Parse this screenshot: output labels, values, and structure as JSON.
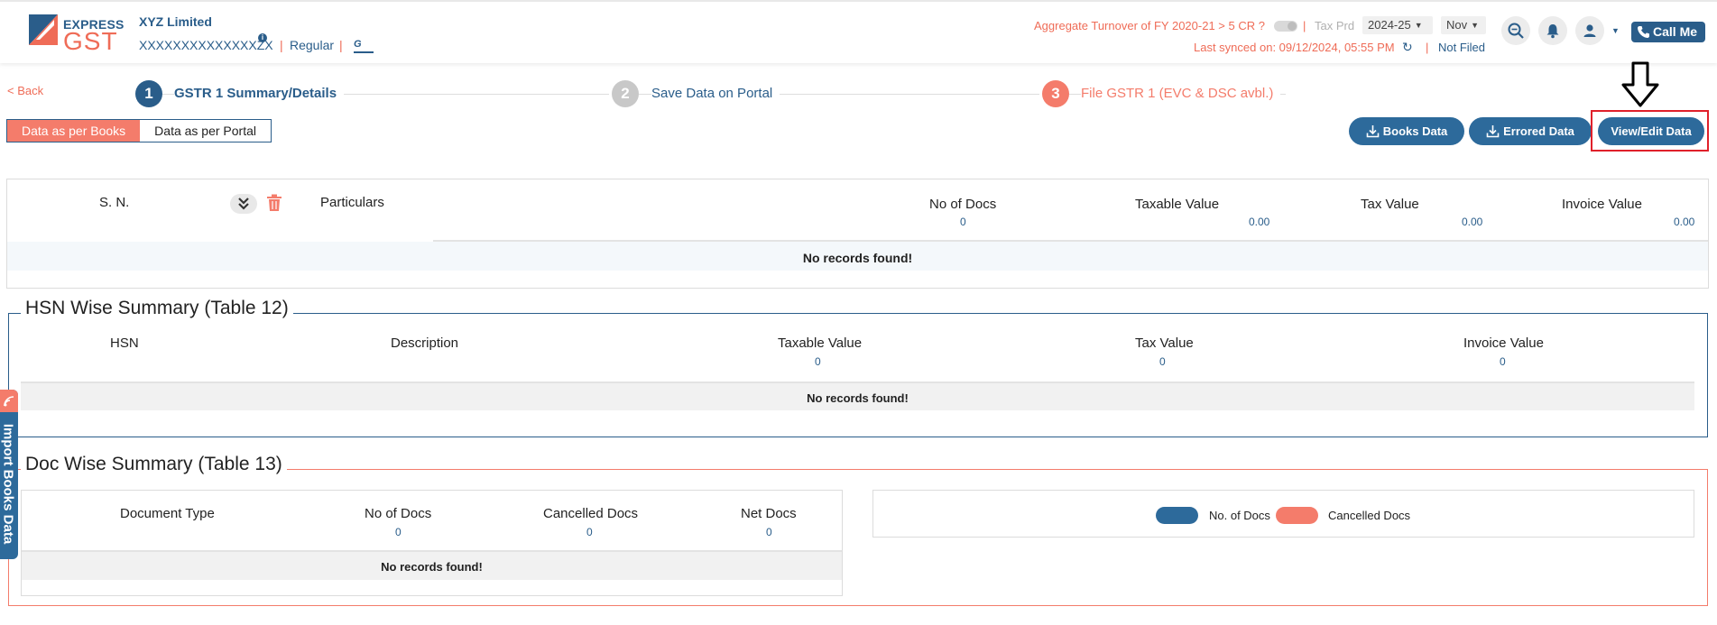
{
  "header": {
    "logo_top": "EXPRESS",
    "logo_bottom": "GST",
    "company_name": "XYZ Limited",
    "gstin": "XXXXXXXXXXXXXXZX",
    "registration_type": "Regular",
    "gstn_logo": "GSTN",
    "turnover_label": "Aggregate Turnover of FY 2020-21 > 5 CR ?",
    "tax_period_label": "Tax Prd",
    "year_value": "2024-25",
    "month_value": "Nov",
    "last_synced": "Last synced on: 09/12/2024, 05:55 PM",
    "filing_status": "Not Filed",
    "call_label": "Call Me",
    "icons": [
      "search-zoom-icon",
      "bell-icon",
      "user-icon",
      "phone-icon",
      "refresh-icon"
    ]
  },
  "steps": {
    "back_label": "< Back",
    "items": [
      {
        "number": "1",
        "label": "GSTR 1 Summary/Details"
      },
      {
        "number": "2",
        "label": "Save Data on Portal"
      },
      {
        "number": "3",
        "label": "File GSTR 1 (EVC & DSC avbl.)"
      }
    ]
  },
  "view_toggle": {
    "books_label": "Data as per Books",
    "portal_label": "Data as per Portal",
    "active": "books"
  },
  "actions": {
    "books_data_label": "Books Data",
    "errored_data_label": "Errored Data",
    "view_edit_label": "View/Edit Data"
  },
  "summary_table": {
    "columns": {
      "sn": "S. N.",
      "particulars": "Particulars",
      "no_of_docs": "No of Docs",
      "taxable_value": "Taxable Value",
      "tax_value": "Tax Value",
      "invoice_value": "Invoice Value"
    },
    "totals": {
      "no_of_docs": "0",
      "taxable_value": "0.00",
      "tax_value": "0.00",
      "invoice_value": "0.00"
    },
    "empty_message": "No records found!"
  },
  "hsn_summary": {
    "title": "HSN Wise Summary (Table 12)",
    "columns": {
      "hsn": "HSN",
      "description": "Description",
      "taxable_value": "Taxable Value",
      "tax_value": "Tax Value",
      "invoice_value": "Invoice Value"
    },
    "totals": {
      "taxable_value": "0",
      "tax_value": "0",
      "invoice_value": "0"
    },
    "empty_message": "No records found!"
  },
  "doc_summary": {
    "title": "Doc Wise Summary (Table 13)",
    "columns": {
      "document_type": "Document Type",
      "no_of_docs": "No of Docs",
      "cancelled_docs": "Cancelled Docs",
      "net_docs": "Net Docs"
    },
    "totals": {
      "no_of_docs": "0",
      "cancelled_docs": "0",
      "net_docs": "0"
    },
    "empty_message": "No records found!",
    "chart_legend": [
      {
        "label": "No. of Docs",
        "color": "#2d6a9b"
      },
      {
        "label": "Cancelled Docs",
        "color": "#f47c6b"
      }
    ]
  },
  "side_tab": {
    "label": "Import Books Data"
  },
  "colors": {
    "brand_blue": "#2a5d8a",
    "accent_coral": "#f47c6b",
    "step_inactive": "#c8c8c8",
    "highlight_red": "#e0202a"
  }
}
